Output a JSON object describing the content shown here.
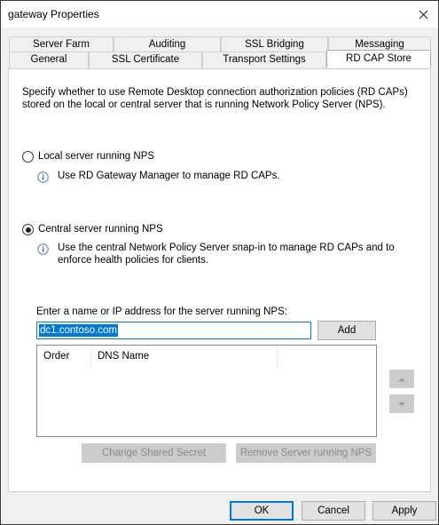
{
  "window": {
    "title": "gateway Properties"
  },
  "tabs_row1": [
    "Server Farm",
    "Auditing",
    "SSL Bridging",
    "Messaging"
  ],
  "tabs_row2": [
    "General",
    "SSL Certificate",
    "Transport Settings",
    "RD CAP Store"
  ],
  "active_tab": "RD CAP Store",
  "description": "Specify whether to use Remote Desktop connection authorization policies (RD CAPs) stored on the local or central server that is running Network Policy Server (NPS).",
  "local_option": {
    "label": "Local server running NPS",
    "selected": false,
    "note": "Use RD Gateway Manager to manage RD CAPs."
  },
  "central_option": {
    "label": "Central server running NPS",
    "selected": true,
    "note": "Use the central Network Policy Server snap-in to manage RD CAPs and to enforce health policies for clients."
  },
  "server_entry": {
    "label": "Enter a name or IP address for the server running NPS:",
    "value": "dc1.contoso.com",
    "add_label": "Add"
  },
  "server_list": {
    "columns": [
      "Order",
      "DNS Name"
    ],
    "rows": []
  },
  "actions": {
    "change_secret": "Change Shared Secret",
    "remove_server": "Remove Server running NPS"
  },
  "dialog_buttons": {
    "ok": "OK",
    "cancel": "Cancel",
    "apply": "Apply"
  },
  "colors": {
    "accent": "#0078d7",
    "disabled_text": "#8a8a8a"
  },
  "icons": [
    "close-icon",
    "info-icon",
    "move-up-icon",
    "move-down-icon"
  ]
}
